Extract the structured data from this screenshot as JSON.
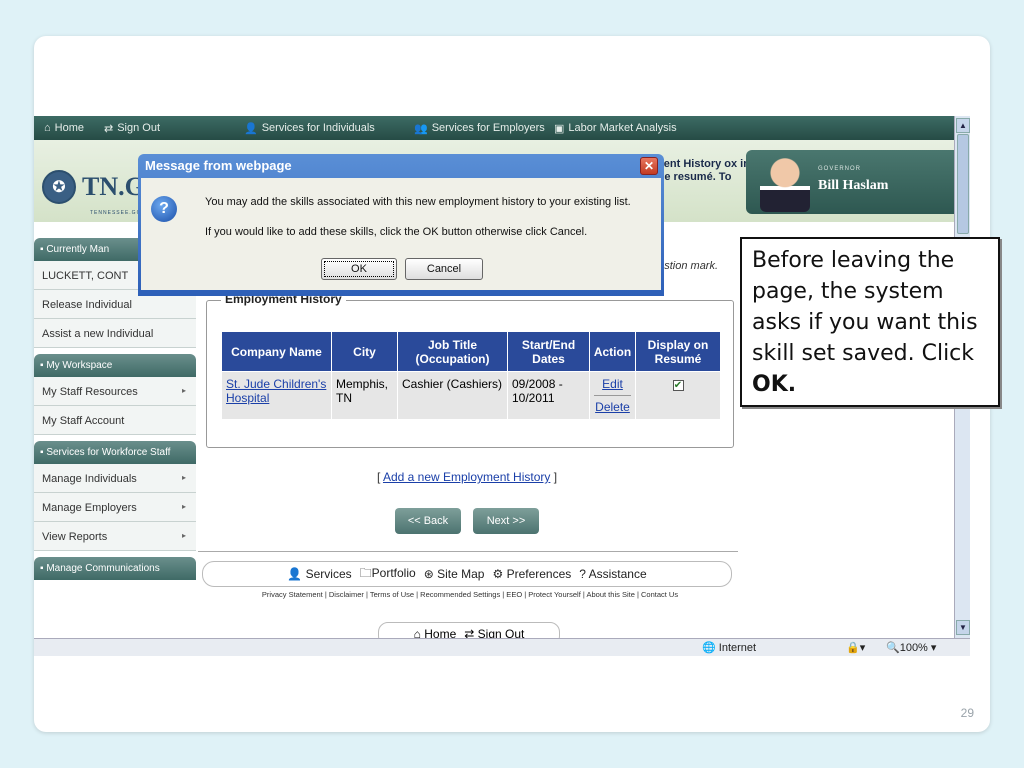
{
  "topnav": {
    "home": "Home",
    "signout": "Sign Out",
    "services_individuals": "Services for Individuals",
    "services_employers": "Services for Employers",
    "labor_market": "Labor Market Analysis"
  },
  "banner": {
    "logo_text": "TN.G",
    "logo_sub": "TENNESSEE.GO",
    "note_lines": "ment History ox in the resumé. To",
    "governor_label": "GOVERNOR",
    "governor_name": "Bill Haslam"
  },
  "sidebar": {
    "currently_managing": "Currently Man",
    "current_user": "LUCKETT, CONT",
    "release": "Release Individual",
    "assist": "Assist a new Individual",
    "my_workspace": "My Workspace",
    "staff_resources": "My Staff Resources",
    "staff_account": "My Staff Account",
    "services_staff": "Services for Workforce Staff",
    "manage_individuals": "Manage Individuals",
    "manage_employers": "Manage Employers",
    "view_reports": "View Reports",
    "manage_comms": "Manage Communications"
  },
  "main": {
    "question_note": "uestion mark.",
    "employment_legend": "Employment History",
    "columns": [
      "Company Name",
      "City",
      "Job Title (Occupation)",
      "Start/End Dates",
      "Action",
      "Display on Resumé"
    ],
    "row": {
      "company": "St. Jude Children's Hospital",
      "city": "Memphis, TN",
      "job": "Cashier (Cashiers)",
      "dates": "09/2008 - 10/2011",
      "edit": "Edit",
      "delete": "Delete"
    },
    "add_link": "Add a new Employment History",
    "back": "<< Back",
    "next": "Next >>",
    "footer": {
      "services": "Services",
      "portfolio": "Portfolio",
      "sitemap": "Site Map",
      "preferences": "Preferences",
      "assistance": "Assistance"
    },
    "legal": "Privacy Statement | Disclaimer | Terms of Use | Recommended Settings | EEO | Protect Yourself | About this Site | Contact Us",
    "home": "Home",
    "signout": "Sign Out"
  },
  "statusbar": {
    "zone": "Internet",
    "zoom": "100%"
  },
  "dialog": {
    "title": "Message from webpage",
    "message1": "You may add the skills associated with this new employment history to your existing list.",
    "message2": "If you would like to add these skills, click the OK button otherwise click Cancel.",
    "ok": "OK",
    "cancel": "Cancel"
  },
  "callout": {
    "text": "Before leaving the page, the system asks if you want this skill set saved. Click",
    "bold": "OK."
  },
  "slide_number": "29"
}
